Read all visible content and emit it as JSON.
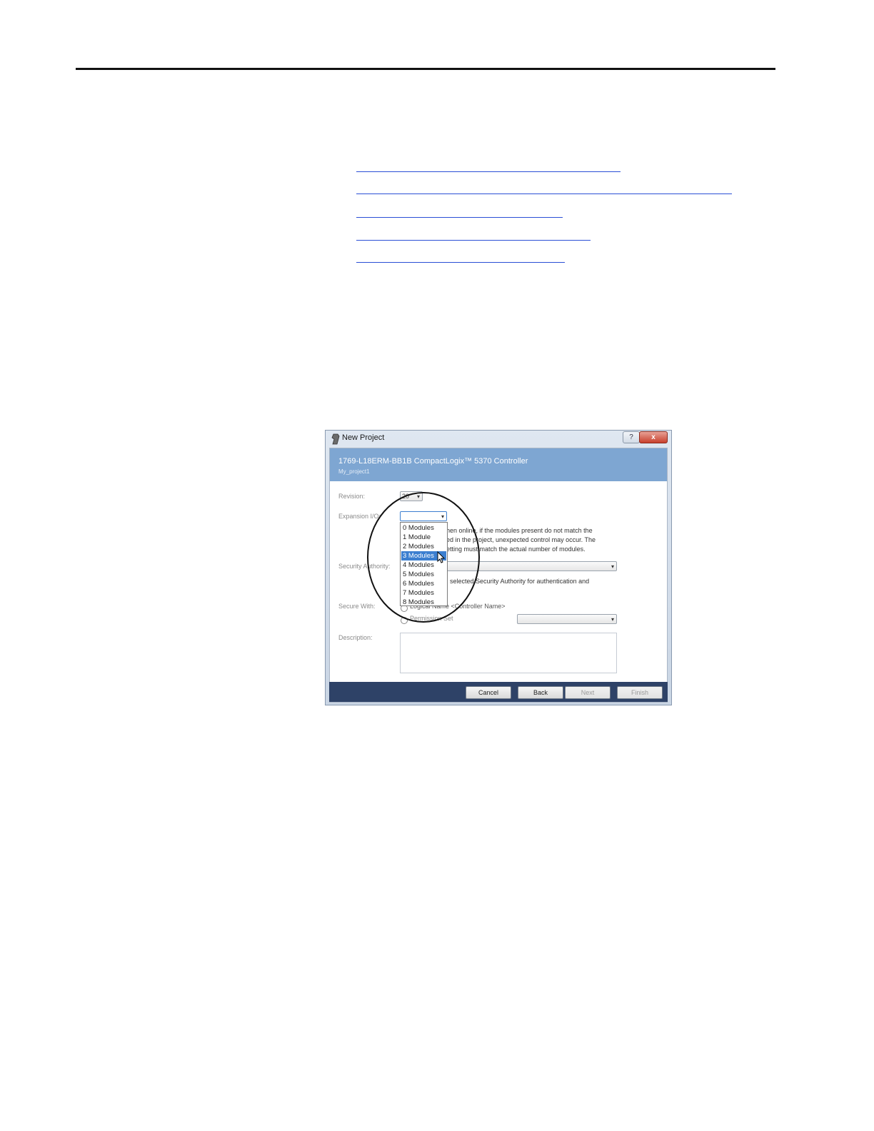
{
  "dialog": {
    "title": "New Project",
    "help_label": "?",
    "close_label": "x",
    "banner_title": "1769-L18ERM-BB1B CompactLogix™ 5370 Controller",
    "banner_subtitle": "My_project1",
    "revision_label": "Revision:",
    "revision_value": "20",
    "expansion_label": "Expansion I/O:",
    "expansion_options": [
      "0 Modules",
      "1 Module",
      "2 Modules",
      "3 Modules",
      "4 Modules",
      "5 Modules",
      "6 Modules",
      "7 Modules",
      "8 Modules"
    ],
    "expansion_selected": "3 Modules",
    "warning_line1": "hen online, if the modules present do not match the",
    "warning_line2": "ed in the project, unexpected control may occur.  The",
    "warning_line3": "etting must match the actual number of modules.",
    "security_label": "Security Authority:",
    "security_note": "selected Security Authority for authentication and",
    "secure_with_label": "Secure With:",
    "secure_option1": "Logical Name <Controller Name>",
    "secure_option2": "Permission Set",
    "description_label": "Description:",
    "buttons": {
      "cancel": "Cancel",
      "back": "Back",
      "next": "Next",
      "finish": "Finish"
    }
  }
}
